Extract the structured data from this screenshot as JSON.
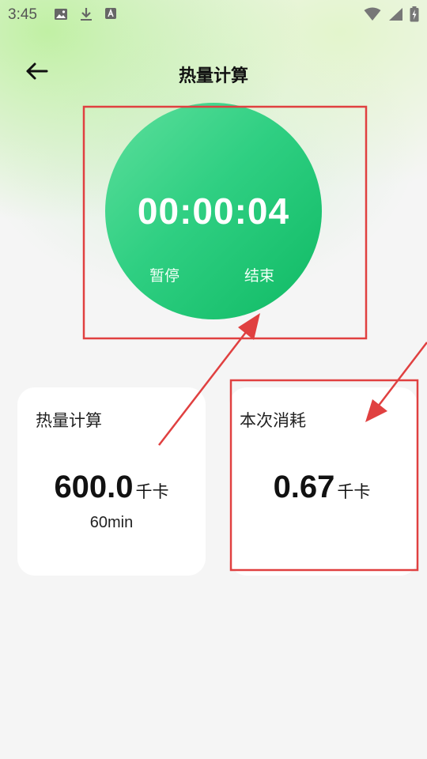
{
  "status_bar": {
    "time": "3:45",
    "left_icons": [
      "image-icon",
      "download-icon",
      "text-a-icon"
    ],
    "right_icons": [
      "wifi-icon",
      "signal-icon",
      "battery-icon"
    ]
  },
  "header": {
    "back_icon": "back-arrow-icon",
    "title": "热量计算"
  },
  "timer": {
    "display": "00:00:04",
    "pause_label": "暂停",
    "end_label": "结束",
    "colors": {
      "start": "#5ddf9c",
      "end": "#0fba64"
    }
  },
  "cards": {
    "calorie_calc": {
      "title": "热量计算",
      "value": "600.0",
      "unit": "千卡",
      "duration": "60min"
    },
    "this_consumption": {
      "title": "本次消耗",
      "value": "0.67",
      "unit": "千卡"
    }
  },
  "annotation_color": "#e04040"
}
